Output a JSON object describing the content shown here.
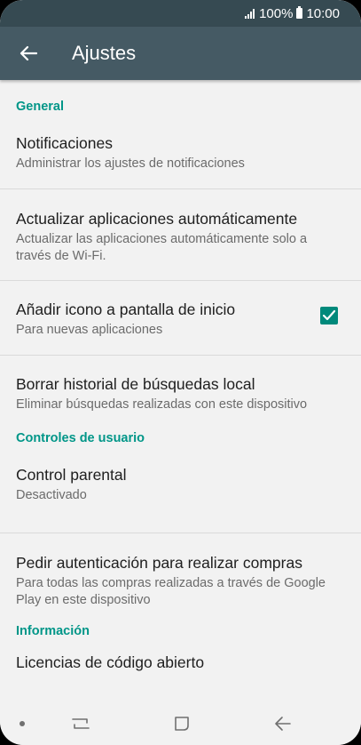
{
  "status_bar": {
    "battery": "100%",
    "time": "10:00"
  },
  "app_bar": {
    "title": "Ajustes"
  },
  "sections": {
    "general": "General",
    "user_controls": "Controles de usuario",
    "info": "Información"
  },
  "items": {
    "notifications": {
      "title": "Notificaciones",
      "subtitle": "Administrar los ajustes de notificaciones"
    },
    "auto_update": {
      "title": "Actualizar aplicaciones automáticamente",
      "subtitle": "Actualizar las aplicaciones automáticamente solo a través de Wi-Fi."
    },
    "add_icon": {
      "title": "Añadir icono a pantalla de inicio",
      "subtitle": "Para nuevas aplicaciones",
      "checked": true
    },
    "clear_history": {
      "title": "Borrar historial de búsquedas  local",
      "subtitle": "Eliminar búsquedas realizadas con este dispositivo"
    },
    "parental": {
      "title": "Control parental",
      "subtitle": "Desactivado"
    },
    "purchase_auth": {
      "title": "Pedir autenticación para realizar compras",
      "subtitle": "Para todas las compras realizadas a través de Google Play en este dispositivo"
    },
    "licenses": {
      "title": "Licencias de código abierto"
    }
  },
  "colors": {
    "accent": "#009688",
    "app_bar": "#455a64",
    "status_bar": "#364a52"
  }
}
